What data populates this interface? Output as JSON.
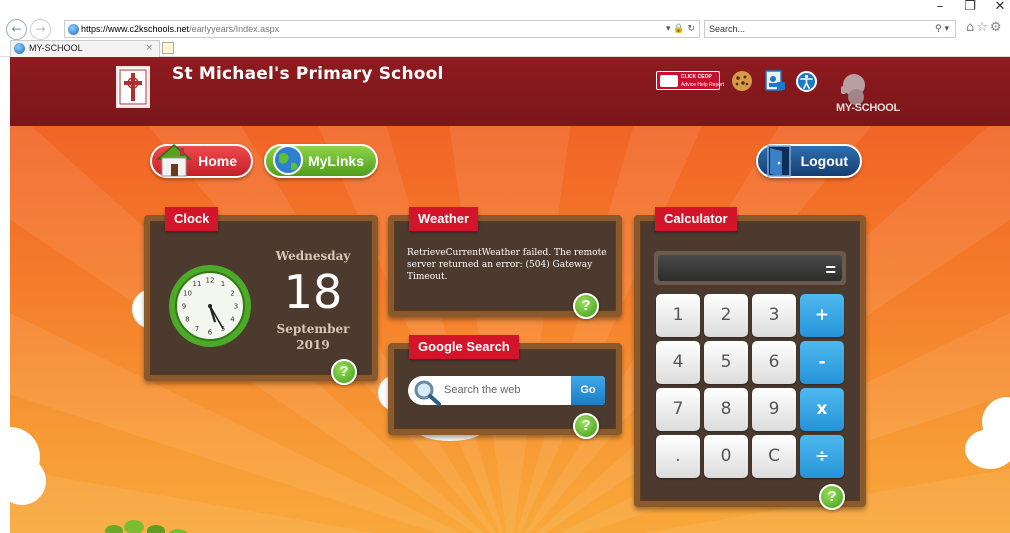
{
  "browser": {
    "url_host": "https://www.c2kschools.net",
    "url_path": "/earlyyears/Index.aspx",
    "search_placeholder": "Search...",
    "tab_title": "MY-SCHOOL",
    "window_controls": [
      "–",
      "❐",
      "✕"
    ]
  },
  "header": {
    "school_name": "St Michael's Primary School",
    "ceop_label": "CLICK CEOP",
    "ceop_sub": "Advice Help Report",
    "brand": "MY-SCHOOL"
  },
  "nav": {
    "home": "Home",
    "mylinks": "MyLinks",
    "logout": "Logout"
  },
  "clock": {
    "title": "Clock",
    "day_name": "Wednesday",
    "day_num": "18",
    "month": "September",
    "year": "2019",
    "hours": 5,
    "minutes": 25
  },
  "weather": {
    "title": "Weather",
    "message": "RetrieveCurrentWeather failed. The remote server returned an error: (504) Gateway Timeout."
  },
  "google": {
    "title": "Google Search",
    "placeholder": "Search the web",
    "go": "Go"
  },
  "calculator": {
    "title": "Calculator",
    "display": "=",
    "keys": [
      "1",
      "2",
      "3",
      "+",
      "4",
      "5",
      "6",
      "-",
      "7",
      "8",
      "9",
      "x",
      ".",
      "0",
      "C",
      "÷"
    ]
  },
  "help_label": "?",
  "colors": {
    "header_bg": "#8e1b1f",
    "tag_red": "#d3152c",
    "help_green": "#4fa820",
    "board_wood": "#8a5a2c",
    "calc_blue": "#2594d8"
  }
}
